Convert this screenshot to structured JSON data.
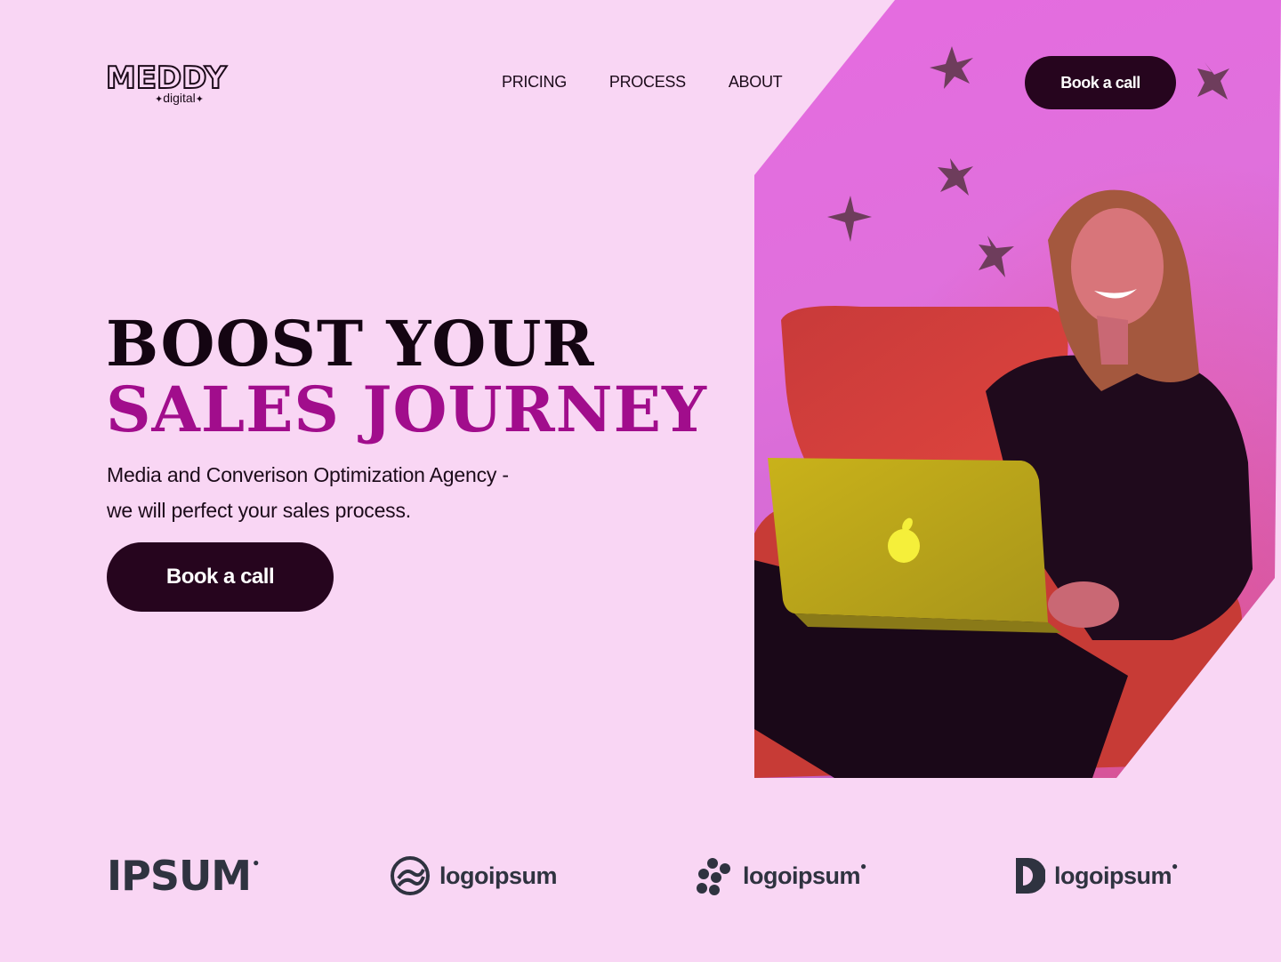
{
  "header": {
    "logo_text": "MEDDY",
    "logo_subtext": "digital",
    "nav": [
      "PRICING",
      "PROCESS",
      "ABOUT"
    ],
    "cta_label": "Book a call"
  },
  "hero": {
    "headline_line1": "BOOST YOUR",
    "headline_line2": "SALES JOURNEY",
    "subtitle_line1": "Media and Converison Optimization Agency -",
    "subtitle_line2": "we will perfect your sales process.",
    "cta_label": "Book a call"
  },
  "partners": [
    {
      "name": "IPSUM",
      "icon": "ipsum-wordmark"
    },
    {
      "name": "logoipsum",
      "icon": "circle-waves-icon"
    },
    {
      "name": "logoipsum",
      "icon": "dots-cluster-icon"
    },
    {
      "name": "logoipsum",
      "icon": "half-circle-icon"
    }
  ],
  "colors": {
    "background": "#f9d6f4",
    "dark": "#26051e",
    "accent": "#a10d8c",
    "photo_pink": "#e56be0",
    "partner_gray": "#2f3340"
  }
}
